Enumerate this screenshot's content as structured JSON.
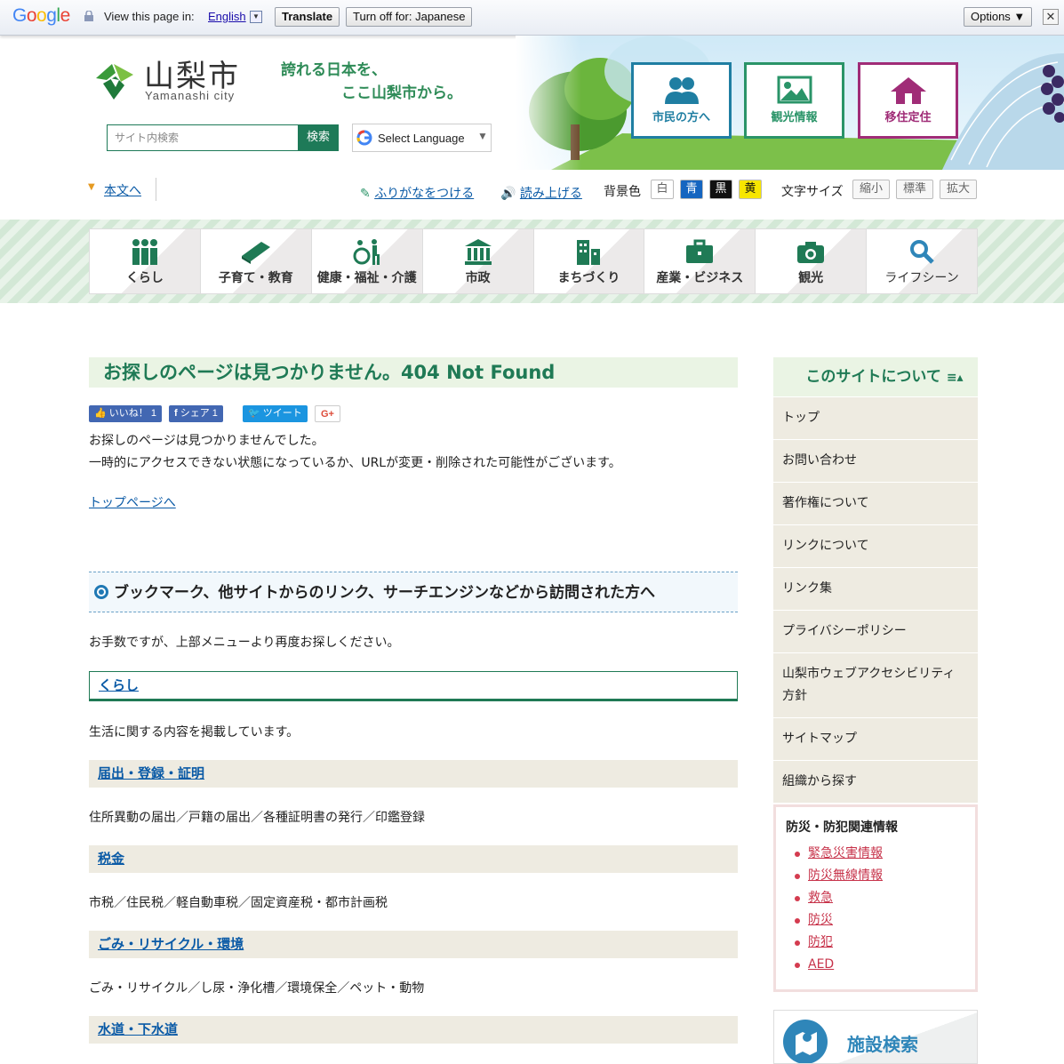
{
  "translate_bar": {
    "logo": "Google",
    "view_text": "View this page in:",
    "language": "English",
    "translate_label": "Translate",
    "turn_off_label": "Turn off for: Japanese",
    "options_label": "Options ▼",
    "close_label": "✕"
  },
  "header": {
    "logo_jp": "山梨市",
    "logo_en": "Yamanashi city",
    "catch_line1": "誇れる日本を、",
    "catch_line2": "ここ山梨市から。",
    "search_placeholder": "サイト内検索",
    "search_button": "検索",
    "select_language": "Select Language",
    "categories": [
      {
        "label": "市民の方へ",
        "color": "#1f7ea2"
      },
      {
        "label": "観光情報",
        "color": "#2a9468"
      },
      {
        "label": "移住定住",
        "color": "#a02c77"
      }
    ],
    "skip_link": "本文へ",
    "furigana": "ふりがなをつける",
    "read_aloud": "読み上げる",
    "bg_color_label": "背景色",
    "bg_colors": [
      "白",
      "青",
      "黒",
      "黄"
    ],
    "font_size_label": "文字サイズ",
    "font_sizes": [
      "縮小",
      "標準",
      "拡大"
    ]
  },
  "gnav": [
    {
      "label": "くらし",
      "icon": "people-icon"
    },
    {
      "label": "子育て・教育",
      "icon": "book-icon"
    },
    {
      "label": "健康・福祉・介護",
      "icon": "wheelchair-icon"
    },
    {
      "label": "市政",
      "icon": "government-building-icon"
    },
    {
      "label": "まちづくり",
      "icon": "buildings-icon"
    },
    {
      "label": "産業・ビジネス",
      "icon": "briefcase-icon"
    },
    {
      "label": "観光",
      "icon": "camera-icon"
    },
    {
      "label": "ライフシーン",
      "icon": "search-icon"
    }
  ],
  "main": {
    "title": "お探しのページは見つかりません。404 Not Found",
    "sns": {
      "like": "いいね！ 1",
      "share": "シェア 1",
      "tweet": "ツイート",
      "gplus": "G+"
    },
    "message_line1": "お探しのページは見つかりませんでした。",
    "message_line2": "一時的にアクセスできない状態になっているか、URLが変更・削除された可能性がございます。",
    "top_link": "トップページへ",
    "section_heading": "ブックマーク、他サイトからのリンク、サーチエンジンなどから訪問された方へ",
    "section_text": "お手数ですが、上部メニューより再度お探しください。",
    "category": {
      "title": "くらし",
      "description": "生活に関する内容を掲載しています。",
      "items": [
        {
          "title": "届出・登録・証明",
          "description": "住所異動の届出／戸籍の届出／各種証明書の発行／印鑑登録"
        },
        {
          "title": "税金",
          "description": "市税／住民税／軽自動車税／固定資産税・都市計画税"
        },
        {
          "title": "ごみ・リサイクル・環境",
          "description": "ごみ・リサイクル／し尿・浄化槽／環境保全／ペット・動物"
        },
        {
          "title": "水道・下水道",
          "description": ""
        }
      ]
    }
  },
  "sidebar": {
    "heading": "このサイトについて",
    "items": [
      "トップ",
      "お問い合わせ",
      "著作権について",
      "リンクについて",
      "リンク集",
      "プライバシーポリシー",
      "山梨市ウェブアクセシビリティ方針",
      "サイトマップ",
      "組織から探す"
    ],
    "bousai_title": "防災・防犯関連情報",
    "bousai_links": [
      "緊急災害情報",
      "防災無線情報",
      "救急",
      "防災",
      "防犯",
      "AED"
    ],
    "facility_search": "施設検索"
  }
}
